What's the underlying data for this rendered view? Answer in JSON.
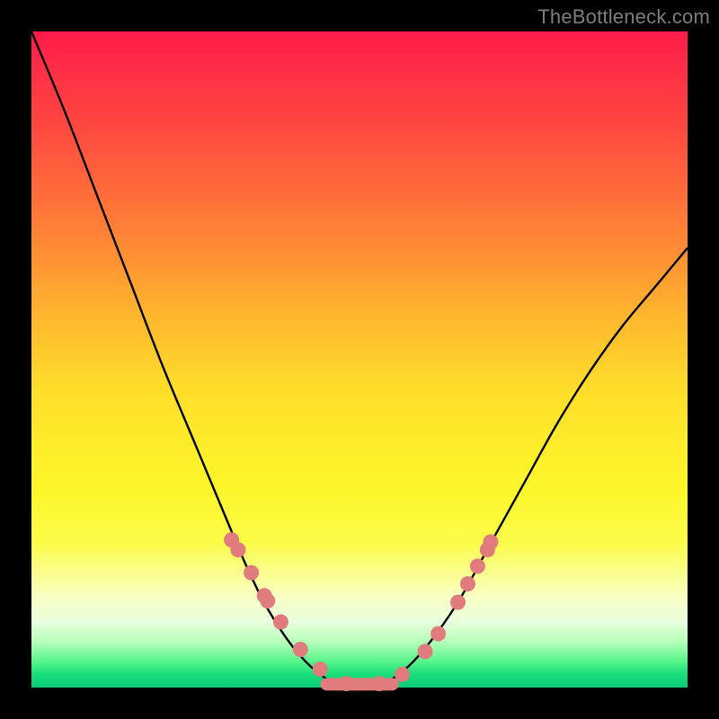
{
  "watermark": "TheBottleneck.com",
  "chart_data": {
    "type": "line",
    "title": "",
    "xlabel": "",
    "ylabel": "",
    "xlim": [
      0,
      1
    ],
    "ylim": [
      0,
      1
    ],
    "series": [
      {
        "name": "bottleneck-curve",
        "x": [
          0.0,
          0.05,
          0.1,
          0.15,
          0.2,
          0.25,
          0.3,
          0.33,
          0.36,
          0.4,
          0.44,
          0.48,
          0.52,
          0.56,
          0.6,
          0.65,
          0.7,
          0.75,
          0.8,
          0.85,
          0.9,
          0.95,
          1.0
        ],
        "y": [
          1.0,
          0.88,
          0.75,
          0.62,
          0.49,
          0.37,
          0.25,
          0.18,
          0.12,
          0.06,
          0.02,
          0.0,
          0.0,
          0.02,
          0.06,
          0.13,
          0.22,
          0.31,
          0.4,
          0.48,
          0.55,
          0.61,
          0.67
        ]
      }
    ],
    "scatter_points": {
      "name": "highlighted-points",
      "x": [
        0.305,
        0.315,
        0.335,
        0.355,
        0.36,
        0.38,
        0.41,
        0.44,
        0.48,
        0.53,
        0.565,
        0.6,
        0.62,
        0.65,
        0.665,
        0.68,
        0.695,
        0.7
      ],
      "y": [
        0.225,
        0.21,
        0.175,
        0.14,
        0.132,
        0.1,
        0.058,
        0.028,
        0.006,
        0.006,
        0.02,
        0.055,
        0.082,
        0.13,
        0.158,
        0.185,
        0.21,
        0.222
      ]
    },
    "flat_valley": {
      "y": 0.005,
      "x_start": 0.45,
      "x_end": 0.55
    }
  },
  "colors": {
    "curve_stroke": "#000000",
    "dot_fill": "#e07b7e",
    "valley_stroke": "#e07b7e"
  }
}
